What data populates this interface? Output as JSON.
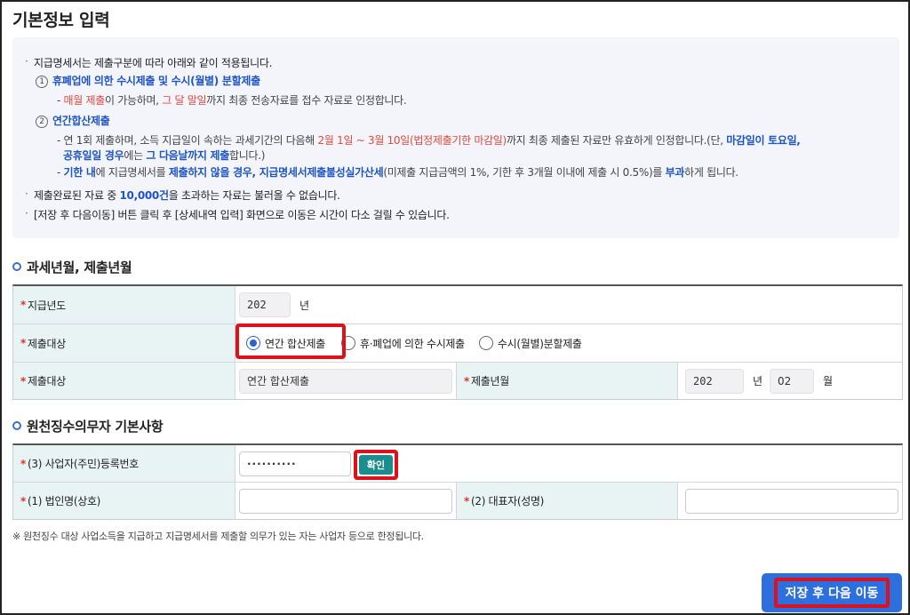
{
  "page_title": "기본정보 입력",
  "notice": {
    "line1": "지급명세서는 제출구분에 따라 아래와 같이 적용됩니다.",
    "item1": {
      "num": "1",
      "title": "휴폐업에 의한 수시제출 및 수시(월별) 분할제출",
      "d1_red1": "매월 제출",
      "d1_t1": "이 가능하며, ",
      "d1_red2": "그 달 말일",
      "d1_t2": "까지 최종 전송자료를 접수 자료로 인정합니다."
    },
    "item2": {
      "num": "2",
      "title": "연간합산제출",
      "d1_t1": "연 1회 제출하며, 소득 지급일이 속하는 과세기간의 다음해 ",
      "d1_red": "2월 1일 ~ 3월 10일(법정제출기한 마감일)",
      "d1_t2": "까지 최종 제출된 자료만 유효하게 인정합니다.(단, ",
      "d1_blue": "마감일이 토요일,",
      "d1b_blue1": "공휴일일 경우",
      "d1b_t1": "에는 ",
      "d1b_blue2": "그 다음날까지 제출",
      "d1b_t2": "합니다.)",
      "d2_blue1": "기한 내",
      "d2_t1": "에 지급명세서를 ",
      "d2_blue2": "제출하지 않을 경우, 지급명세서제출불성실가산세",
      "d2_t2": "(미제출 지급금액의 1%, 기한 후 3개월 이내에 제출 시 0.5%)를 ",
      "d2_blue3": "부과",
      "d2_t3": "하게 됩니다."
    },
    "line_limit_t1": "제출완료된 자료 중 ",
    "line_limit_blue": "10,000건",
    "line_limit_t2": "을 초과하는 자료는 불러올 수 없습니다.",
    "line_move": "[저장 후 다음이동] 버튼 클릭 후 [상세내역 입력] 화면으로 이동은 시간이 다소 걸릴 수 있습니다."
  },
  "section1": {
    "title": "과세년월, 제출년월",
    "payment_year_label": "지급년도",
    "payment_year_value": "202",
    "year_unit": "년",
    "target_label": "제출대상",
    "radio_options": [
      "연간 합산제출",
      "휴·폐업에 의한 수시제출",
      "수시(월별)분할제출"
    ],
    "radio_selected": "연간 합산제출",
    "target_label2": "제출대상",
    "target_value": "연간 합산제출",
    "submit_ym_label": "제출년월",
    "submit_year_value": "202",
    "submit_month_value": "02",
    "month_unit": "월"
  },
  "section2": {
    "title": "원천징수의무자 기본사항",
    "bizno_label": "(3) 사업자(주민)등록번호",
    "bizno_value": "··········",
    "confirm_label": "확인",
    "corp_label": "(1) 법인명(상호)",
    "corp_value": "",
    "rep_label": "(2) 대표자(성명)",
    "rep_value": ""
  },
  "footnote": "※ 원천징수 대상 사업소득을 지급하고 지급명세서를 제출할 의무가 있는 자는 사업자 등으로 한정됩니다.",
  "save_button": "저장 후 다음 이동",
  "required_mark": "*"
}
